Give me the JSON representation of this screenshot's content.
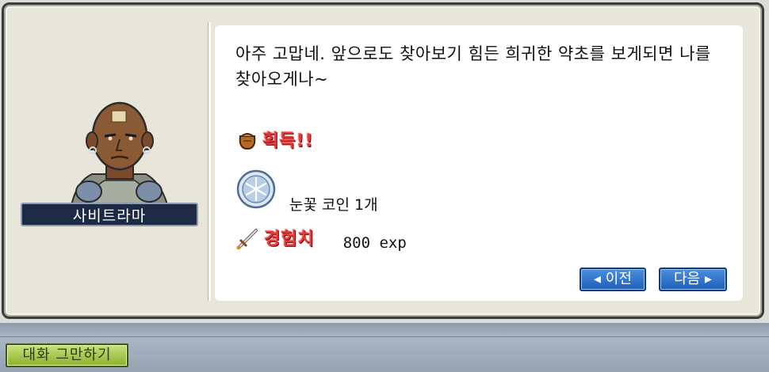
{
  "npc": {
    "name": "사비트라마"
  },
  "dialog": {
    "message": "아주 고맙네. 앞으로도 찾아보기 힘든 희귀한 약초를 보게되면 나를 찾아오게나~",
    "obtain_heading": "획득!!",
    "item": {
      "name": "눈꽃 코인 1개",
      "icon": "snowflake-coin-icon"
    },
    "exp_heading": "경험치",
    "exp_value": "800 exp"
  },
  "buttons": {
    "prev_label": "◂ 이전",
    "next_label": "다음 ▸",
    "end_chat_label": "대화 그만하기"
  },
  "colors": {
    "reward_heading": "#e43b3b",
    "nav_button": "#1f5fb8",
    "end_chat_button": "#8bb02e",
    "name_plate": "#1c2a45"
  }
}
